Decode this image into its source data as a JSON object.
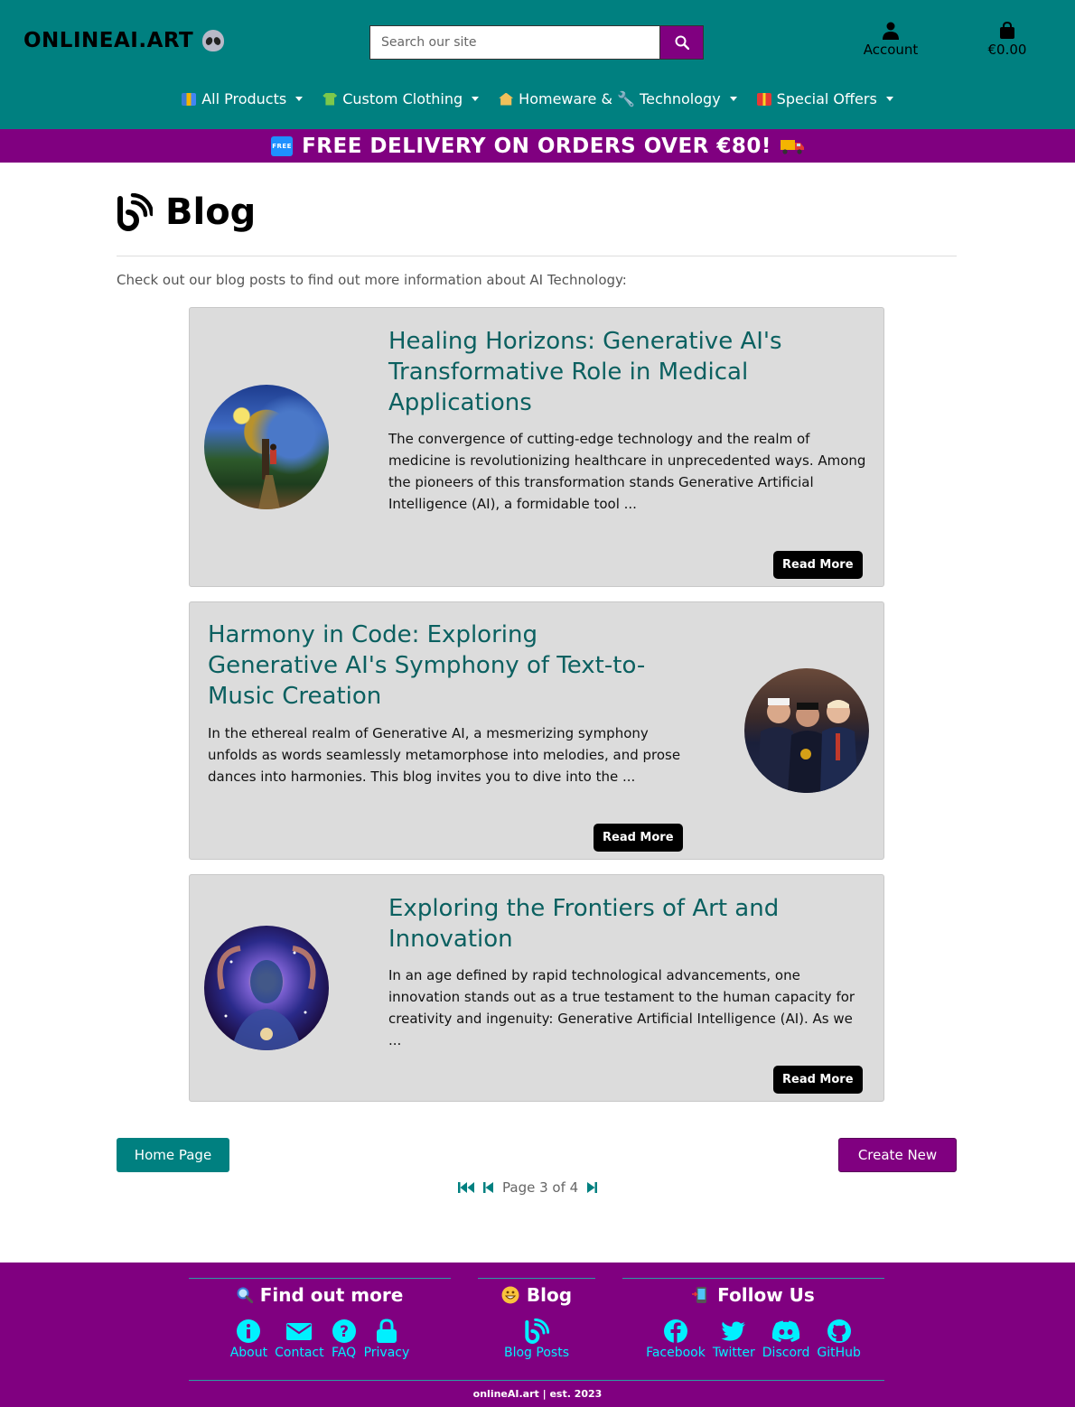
{
  "header": {
    "logo_text": "ONLINEAI.ART",
    "search_placeholder": "Search our site",
    "account_label": "Account",
    "cart_total": "€0.00"
  },
  "nav": {
    "items": [
      {
        "label": "All Products",
        "icon": "books-emoji"
      },
      {
        "label": "Custom Clothing",
        "icon": "tshirt-emoji"
      },
      {
        "label": "Homeware & 🔧 Technology",
        "icon": "house-emoji"
      },
      {
        "label": "Special Offers",
        "icon": "gift-emoji"
      }
    ]
  },
  "banner": {
    "free_badge": "FREE",
    "text": "FREE DELIVERY ON ORDERS OVER €80!"
  },
  "page": {
    "title": "Blog",
    "intro": "Check out our blog posts to find out more information about AI Technology:"
  },
  "posts": [
    {
      "title": "Healing Horizons: Generative AI's Transformative Role in Medical Applications",
      "excerpt": "The convergence of cutting-edge technology and the realm of medicine is revolutionizing healthcare in unprecedented ways. Among the pioneers of this transformation stands Generative Artificial Intelligence (AI), a formidable tool ...",
      "read_more": "Read More",
      "image": "tree-starry-night-painting"
    },
    {
      "title": "Harmony in Code: Exploring Generative AI's Symphony of Text-to-Music Creation",
      "excerpt": "In the ethereal realm of Generative AI, a mesmerizing symphony unfolds as words seamlessly metamorphose into melodies, and prose dances into harmonies. This blog invites you to dive into the ...",
      "read_more": "Read More",
      "image": "three-men-in-suits"
    },
    {
      "title": "Exploring the Frontiers of Art and Innovation",
      "excerpt": "In an age defined by rapid technological advancements, one innovation stands out as a true testament to the human capacity for creativity and ingenuity: Generative Artificial Intelligence (AI). As we ...",
      "read_more": "Read More",
      "image": "cosmic-figure"
    }
  ],
  "actions": {
    "home_label": "Home Page",
    "create_label": "Create New"
  },
  "pagination": {
    "text": "Page 3 of 4",
    "current": 3,
    "total": 4
  },
  "footer": {
    "sections": [
      {
        "title": "Find out more",
        "icon": "magnifier-emoji",
        "links": [
          "About",
          "Contact",
          "FAQ",
          "Privacy"
        ]
      },
      {
        "title": "Blog",
        "icon": "grin-emoji",
        "links": [
          "Blog Posts"
        ]
      },
      {
        "title": "Follow Us",
        "icon": "phone-emoji",
        "links": [
          "Facebook",
          "Twitter",
          "Discord",
          "GitHub"
        ]
      }
    ],
    "copyright": "onlineAI.art | est. 2023"
  },
  "colors": {
    "teal": "#008080",
    "purple": "#800080",
    "title_teal": "#0b6060",
    "footer_link": "#00f0ff"
  }
}
